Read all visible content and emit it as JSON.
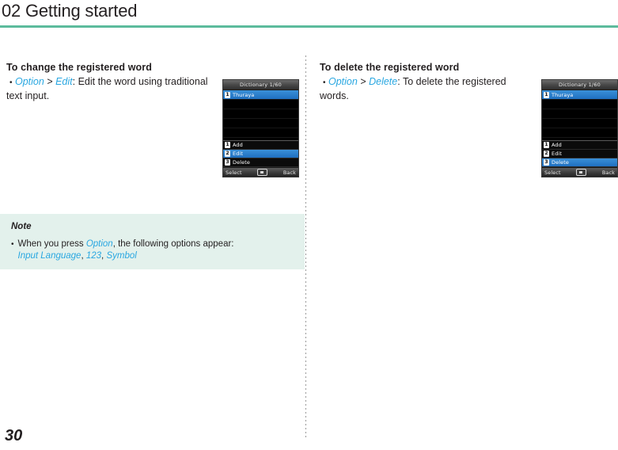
{
  "header": {
    "chapter_title": "02 Getting started",
    "rule_color": "#5cbb9c"
  },
  "left_column": {
    "heading": "To change the registered word",
    "bullet": "•",
    "line_parts": {
      "kw1": "Option",
      "sep": " > ",
      "kw2": "Edit",
      "text": ": Edit the word using traditional text input."
    }
  },
  "right_column": {
    "heading": "To delete the registered word",
    "bullet": "•",
    "line_parts": {
      "kw1": "Option",
      "sep": " > ",
      "kw2": "Delete",
      "text": ": To delete the registered words."
    }
  },
  "phone_screen_left": {
    "title": "Dictionary 1/60",
    "list": [
      {
        "num": "1",
        "label": "Thuraya",
        "selected": true
      }
    ],
    "menu": [
      {
        "num": "1",
        "label": "Add",
        "selected": false
      },
      {
        "num": "2",
        "label": "Edit",
        "selected": true
      },
      {
        "num": "3",
        "label": "Delete",
        "selected": false
      }
    ],
    "softkey_left": "Select",
    "softkey_center_icon": "ok-key-icon",
    "softkey_right": "Back"
  },
  "phone_screen_right": {
    "title": "Dictionary 1/60",
    "list": [
      {
        "num": "1",
        "label": "Thuraya",
        "selected": true
      }
    ],
    "menu": [
      {
        "num": "1",
        "label": "Add",
        "selected": false
      },
      {
        "num": "2",
        "label": "Edit",
        "selected": false
      },
      {
        "num": "3",
        "label": "Delete",
        "selected": true
      }
    ],
    "softkey_left": "Select",
    "softkey_center_icon": "ok-key-icon",
    "softkey_right": "Back"
  },
  "note": {
    "title": "Note",
    "bullet": "•",
    "text_part1": "When you press ",
    "kw_option": "Option",
    "text_part2": ", the following options appear:",
    "kw_input_language": "Input Language",
    "comma1": ", ",
    "kw_123": "123",
    "comma2": ", ",
    "kw_symbol": "Symbol",
    "background": "#e3f1ec"
  },
  "footer": {
    "page_number": "30"
  }
}
